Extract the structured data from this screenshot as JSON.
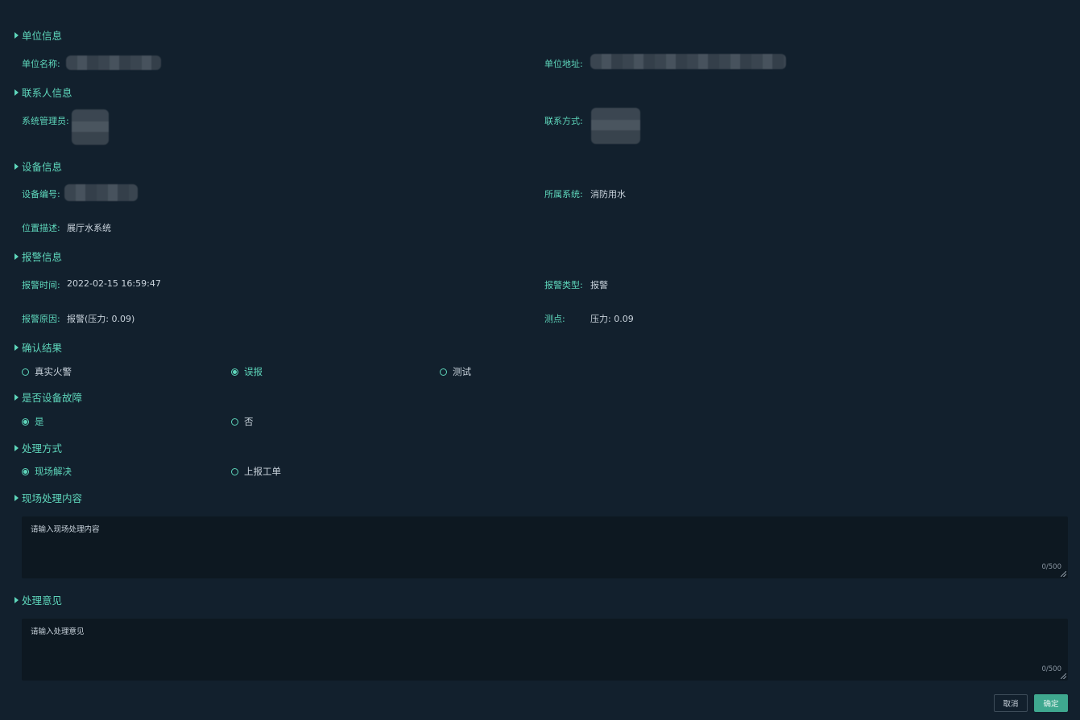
{
  "sections": {
    "unit": "单位信息",
    "contact": "联系人信息",
    "device": "设备信息",
    "alarm": "报警信息",
    "confirm": "确认结果",
    "fault": "是否设备故障",
    "handling": "处理方式",
    "onsite_content": "现场处理内容",
    "opinion": "处理意见"
  },
  "fields": {
    "unit_name_label": "单位名称:",
    "unit_address_label": "单位地址:",
    "admin_label": "系统管理员:",
    "contact_method_label": "联系方式:",
    "device_no_label": "设备编号:",
    "system_label": "所属系统:",
    "system_value": "消防用水",
    "location_label": "位置描述:",
    "location_value": "展厅水系统",
    "alarm_time_label": "报警时间:",
    "alarm_time_value": "2022-02-15 16:59:47",
    "alarm_type_label": "报警类型:",
    "alarm_type_value": "报警",
    "alarm_reason_label": "报警原因:",
    "alarm_reason_value": "报警(压力: 0.09)",
    "point_label": "测点:",
    "point_value": "压力: 0.09"
  },
  "confirm_options": [
    {
      "label": "真实火警",
      "checked": false
    },
    {
      "label": "误报",
      "checked": true
    },
    {
      "label": "测试",
      "checked": false
    }
  ],
  "fault_options": [
    {
      "label": "是",
      "checked": true
    },
    {
      "label": "否",
      "checked": false
    }
  ],
  "handling_options": [
    {
      "label": "现场解决",
      "checked": true
    },
    {
      "label": "上报工单",
      "checked": false
    }
  ],
  "onsite_textarea": {
    "placeholder": "请输入现场处理内容",
    "counter": "0/500"
  },
  "opinion_textarea": {
    "placeholder": "请输入处理意见",
    "counter": "0/500"
  },
  "buttons": {
    "cancel": "取消",
    "ok": "确定"
  },
  "colors": {
    "accent": "#5ed6bb",
    "background": "#12202d",
    "primary_button": "#3fa88f"
  }
}
